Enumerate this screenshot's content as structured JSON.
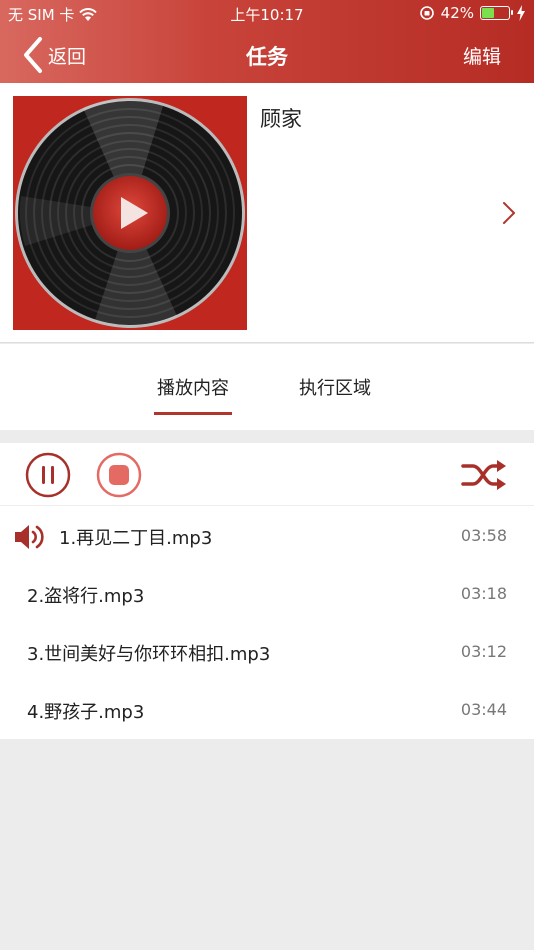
{
  "status_bar": {
    "carrier": "无 SIM 卡",
    "time": "上午10:17",
    "battery": "42%"
  },
  "nav": {
    "back_label": "返回",
    "title": "任务",
    "edit_label": "编辑"
  },
  "header": {
    "name": "顾家"
  },
  "tabs": [
    {
      "label": "播放内容",
      "active": true
    },
    {
      "label": "执行区域",
      "active": false
    }
  ],
  "tracks": [
    {
      "name": "1.再见二丁目.mp3",
      "duration": "03:58",
      "playing": true
    },
    {
      "name": "2.盗将行.mp3",
      "duration": "03:18"
    },
    {
      "name": "3.世间美好与你环环相扣.mp3",
      "duration": "03:12"
    },
    {
      "name": "4.野孩子.mp3",
      "duration": "03:44"
    }
  ],
  "colors": {
    "accent": "#b0352c",
    "bar_start": "#d8685f",
    "bar_end": "#b52c24",
    "battery": "#7be04d"
  }
}
